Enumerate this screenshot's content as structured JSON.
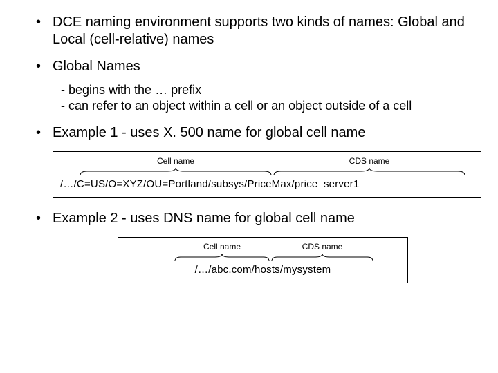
{
  "bullets": {
    "b1": "DCE naming environment supports two kinds of names: Global and Local (cell-relative) names",
    "b2": "Global Names",
    "b2_sub1": "- begins with the … prefix",
    "b2_sub2": "- can refer to an object within a cell or an object outside of a cell",
    "b3": "Example 1 - uses X. 500 name for global cell name",
    "b4": "Example 2 - uses DNS name for global cell name"
  },
  "figure1": {
    "cell_label": "Cell name",
    "cds_label": "CDS name",
    "path": "/…/C=US/O=XYZ/OU=Portland/subsys/PriceMax/price_server1"
  },
  "figure2": {
    "cell_label": "Cell name",
    "cds_label": "CDS name",
    "path": "/…/abc.com/hosts/mysystem"
  }
}
